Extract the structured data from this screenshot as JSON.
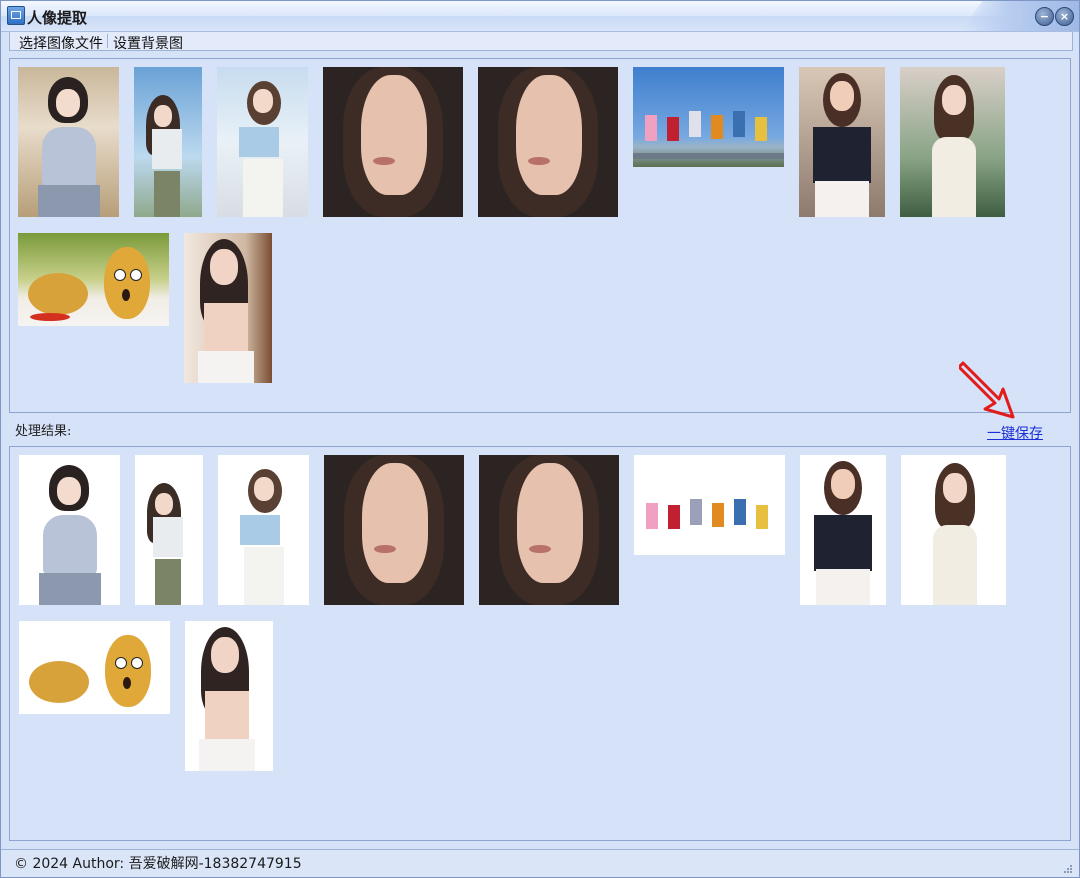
{
  "window": {
    "title": "人像提取"
  },
  "menu": {
    "items": [
      "选择图像文件",
      "设置背景图"
    ]
  },
  "results": {
    "label": "处理结果:",
    "save_link": "一键保存"
  },
  "status": {
    "text": "© 2024 Author: 吾爱破解网-18382747915"
  },
  "colors": {
    "accent": "#1b2fd6",
    "panel_bg": "#d6e2f8",
    "arrow": "#e21b1b"
  },
  "icons": [
    "app-icon",
    "minimize-icon",
    "close-icon",
    "size-grip-icon",
    "arrow-icon"
  ]
}
